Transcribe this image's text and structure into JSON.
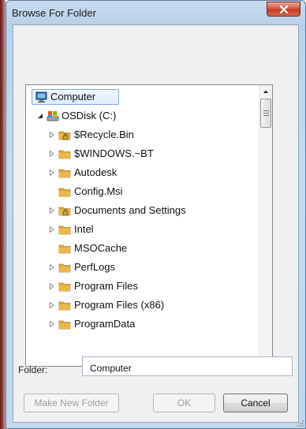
{
  "window": {
    "title": "Browse For Folder",
    "close_label": "Close"
  },
  "tree": {
    "root": {
      "label": "Computer",
      "selected": true,
      "icon": "computer-icon"
    },
    "drive": {
      "label": "OSDisk (C:)",
      "expanded": true,
      "icon": "drive-icon"
    },
    "items": [
      {
        "label": "$Recycle.Bin",
        "has_children": true,
        "icon": "locked-folder-icon"
      },
      {
        "label": "$WINDOWS.~BT",
        "has_children": true,
        "icon": "folder-icon"
      },
      {
        "label": "Autodesk",
        "has_children": true,
        "icon": "folder-icon"
      },
      {
        "label": "Config.Msi",
        "has_children": false,
        "icon": "folder-icon"
      },
      {
        "label": "Documents and Settings",
        "has_children": true,
        "icon": "locked-folder-icon"
      },
      {
        "label": "Intel",
        "has_children": true,
        "icon": "folder-icon"
      },
      {
        "label": "MSOCache",
        "has_children": false,
        "icon": "folder-icon"
      },
      {
        "label": "PerfLogs",
        "has_children": true,
        "icon": "folder-icon"
      },
      {
        "label": "Program Files",
        "has_children": true,
        "icon": "folder-icon"
      },
      {
        "label": "Program Files (x86)",
        "has_children": true,
        "icon": "folder-icon"
      },
      {
        "label": "ProgramData",
        "has_children": true,
        "icon": "folder-icon"
      }
    ]
  },
  "folder_field": {
    "label": "Folder:",
    "value": "Computer"
  },
  "buttons": {
    "make_new_folder": "Make New Folder",
    "ok": "OK",
    "cancel": "Cancel"
  },
  "colors": {
    "title_bar": "#bdd3ea",
    "close_button": "#c9462e",
    "selection_border": "#84acdd",
    "folder": "#e8b84a"
  }
}
